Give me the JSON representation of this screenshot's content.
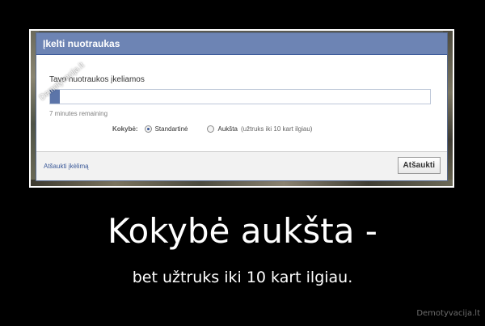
{
  "dialog": {
    "title": "Įkelti nuotraukas",
    "progress_label": "Tavo nuotraukos įkeliamos",
    "progress_fraction": 0.025,
    "remaining_text": "7 minutes remaining",
    "quality_label": "Kokybė:",
    "quality_options": [
      {
        "label": "Standartinė",
        "hint": "",
        "selected": true
      },
      {
        "label": "Aukšta",
        "hint": "(užtruks iki 10 kart ilgiau)",
        "selected": false
      }
    ],
    "cancel_upload_link": "Atšaukti įkėlimą",
    "cancel_button": "Atšaukti"
  },
  "watermark": "Demotyvacija.lt",
  "caption": {
    "headline": "Kokybė aukšta -",
    "subline": "bet užtruks iki 10 kart ilgiau."
  },
  "site_credit": "Demotyvacija.lt",
  "colors": {
    "header_bg": "#6d84b4",
    "progress_fill": "#5c75a9",
    "link": "#3b5998"
  }
}
